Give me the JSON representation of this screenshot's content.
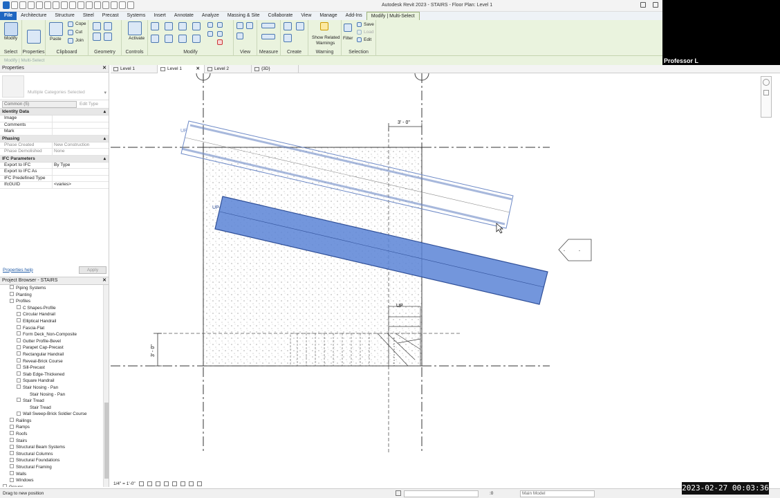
{
  "window": {
    "title": "Autodesk Revit 2023 - STAIRS - Floor Plan: Level 1"
  },
  "presenter": {
    "name": "Professor L"
  },
  "ribbon_tabs": [
    "File",
    "Architecture",
    "Structure",
    "Steel",
    "Precast",
    "Systems",
    "Insert",
    "Annotate",
    "Analyze",
    "Massing & Site",
    "Collaborate",
    "View",
    "Manage",
    "Add-Ins",
    "Modify | Multi-Select"
  ],
  "ribbon": {
    "select": {
      "modify": "Modify",
      "panel": "Select"
    },
    "properties": {
      "panel": "Properties"
    },
    "clipboard": {
      "paste": "Paste",
      "cope": "Cope",
      "cut": "Cut",
      "join": "Join",
      "panel": "Clipboard"
    },
    "geometry": {
      "panel": "Geometry"
    },
    "controls": {
      "activate": "Activate",
      "panel": "Controls"
    },
    "modify": {
      "panel": "Modify"
    },
    "view": {
      "panel": "View"
    },
    "measure": {
      "panel": "Measure"
    },
    "create": {
      "panel": "Create"
    },
    "warning": {
      "show_related": "Show Related",
      "warnings": "Warnings",
      "panel": "Warning"
    },
    "selection": {
      "filter": "Filter",
      "save": "Save",
      "load": "Load",
      "edit": "Edit",
      "panel": "Selection"
    }
  },
  "context_bar": "Modify | Multi-Select",
  "properties": {
    "title": "Properties",
    "type_name": "Multiple Categories Selected",
    "filter_value": "Common (5)",
    "edit_type": "Edit Type",
    "groups": [
      {
        "name": "Identity Data",
        "rows": [
          {
            "k": "Image",
            "v": ""
          },
          {
            "k": "Comments",
            "v": ""
          },
          {
            "k": "Mark",
            "v": ""
          }
        ]
      },
      {
        "name": "Phasing",
        "rows": [
          {
            "k": "Phase Created",
            "v": "New Construction"
          },
          {
            "k": "Phase Demolished",
            "v": "None"
          }
        ]
      },
      {
        "name": "IFC Parameters",
        "rows": [
          {
            "k": "Export to IFC",
            "v": "By Type"
          },
          {
            "k": "Export to IFC As",
            "v": ""
          },
          {
            "k": "IFC Predefined Type",
            "v": ""
          },
          {
            "k": "IfcGUID",
            "v": "<varies>"
          }
        ]
      }
    ],
    "help_link": "Properties help",
    "apply": "Apply"
  },
  "project_browser": {
    "title": "Project Browser - STAIRS",
    "items": [
      {
        "label": "Piping Systems",
        "indent": 1,
        "tog": "+"
      },
      {
        "label": "Planting",
        "indent": 1,
        "tog": "+"
      },
      {
        "label": "Profiles",
        "indent": 1,
        "tog": "-"
      },
      {
        "label": "C Shapes-Profile",
        "indent": 2,
        "tog": "+"
      },
      {
        "label": "Circular Handrail",
        "indent": 2,
        "tog": "+"
      },
      {
        "label": "Elliptical Handrail",
        "indent": 2,
        "tog": "+"
      },
      {
        "label": "Fascia-Flat",
        "indent": 2,
        "tog": "+"
      },
      {
        "label": "Form Deck_Non-Composite",
        "indent": 2,
        "tog": "+"
      },
      {
        "label": "Gutter Profile-Bevel",
        "indent": 2,
        "tog": "+"
      },
      {
        "label": "Parapet Cap-Precast",
        "indent": 2,
        "tog": "+"
      },
      {
        "label": "Rectangular Handrail",
        "indent": 2,
        "tog": "+"
      },
      {
        "label": "Reveal-Brick Course",
        "indent": 2,
        "tog": "+"
      },
      {
        "label": "Sill-Precast",
        "indent": 2,
        "tog": "+"
      },
      {
        "label": "Slab Edge-Thickened",
        "indent": 2,
        "tog": "+"
      },
      {
        "label": "Square Handrail",
        "indent": 2,
        "tog": "+"
      },
      {
        "label": "Stair Nosing - Pan",
        "indent": 2,
        "tog": "-"
      },
      {
        "label": "Stair Nosing - Pan",
        "indent": 3,
        "tog": ""
      },
      {
        "label": "Stair Tread",
        "indent": 2,
        "tog": "-"
      },
      {
        "label": "Stair Tread",
        "indent": 3,
        "tog": ""
      },
      {
        "label": "Wall Sweep-Brick Soldier Course",
        "indent": 2,
        "tog": "+"
      },
      {
        "label": "Railings",
        "indent": 1,
        "tog": "+"
      },
      {
        "label": "Ramps",
        "indent": 1,
        "tog": "+"
      },
      {
        "label": "Roofs",
        "indent": 1,
        "tog": "+"
      },
      {
        "label": "Stairs",
        "indent": 1,
        "tog": "+"
      },
      {
        "label": "Structural Beam Systems",
        "indent": 1,
        "tog": "+"
      },
      {
        "label": "Structural Columns",
        "indent": 1,
        "tog": "+"
      },
      {
        "label": "Structural Foundations",
        "indent": 1,
        "tog": "+"
      },
      {
        "label": "Structural Framing",
        "indent": 1,
        "tog": "+"
      },
      {
        "label": "Walls",
        "indent": 1,
        "tog": "+"
      },
      {
        "label": "Windows",
        "indent": 1,
        "tog": "+"
      },
      {
        "label": "Groups",
        "indent": 0,
        "tog": "+"
      }
    ]
  },
  "view_tabs": [
    {
      "label": "Level 1",
      "active": false
    },
    {
      "label": "Level 1",
      "active": true
    },
    {
      "label": "Level 2",
      "active": false
    },
    {
      "label": "{3D}",
      "active": false
    }
  ],
  "drawing": {
    "dim_top": "3' - 0\"",
    "dim_left": "3' - 0\"",
    "up_label": "UP",
    "selection_color": "#5b84d6"
  },
  "view_control": {
    "scale": "1/4\" = 1'-0\""
  },
  "status": {
    "message": "Drag to new position",
    "zero": ":0",
    "model": "Main Model"
  },
  "timestamp": "2023-02-27  00:03:36"
}
